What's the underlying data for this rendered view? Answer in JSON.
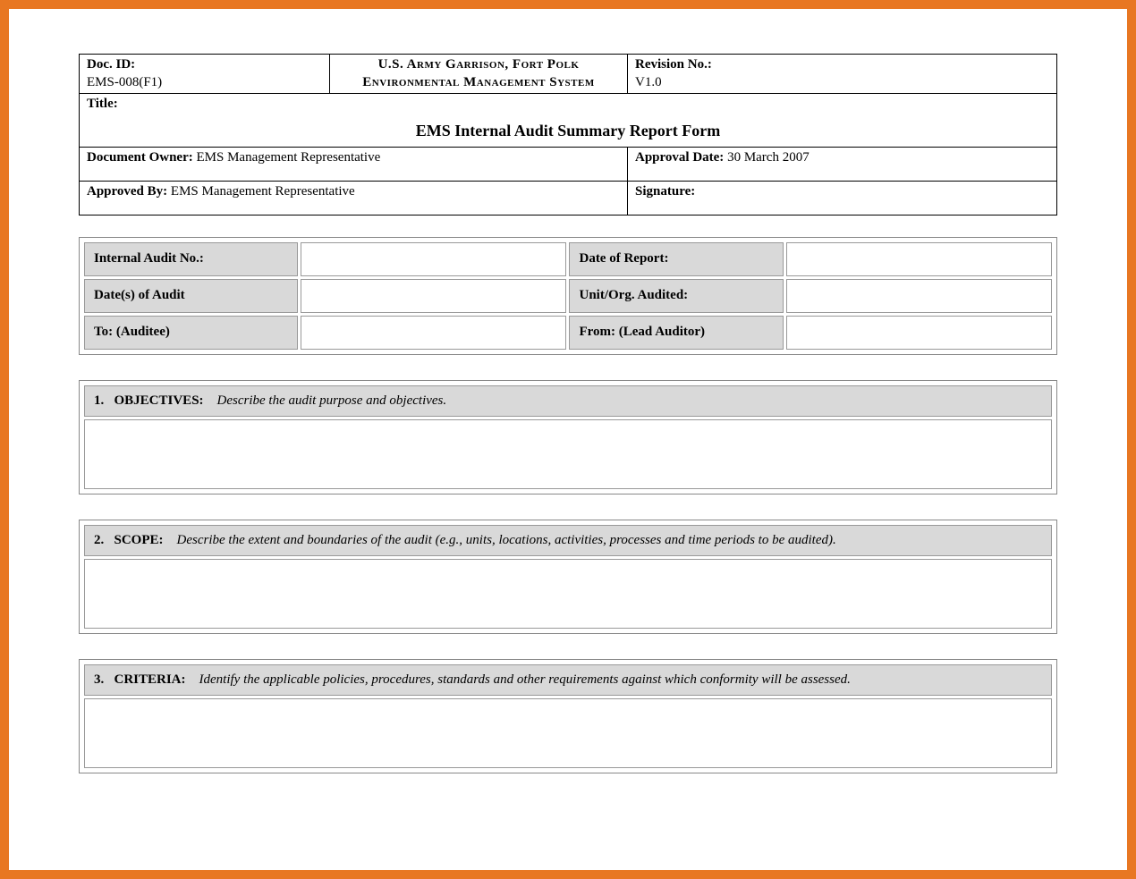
{
  "header": {
    "doc_id_label": "Doc. ID:",
    "doc_id_value": "EMS-008(F1)",
    "org_line1": "U.S. Army Garrison, Fort Polk",
    "org_line2": "Environmental Management System",
    "revision_label": "Revision No.:",
    "revision_value": "V1.0",
    "title_label": "Title:",
    "form_title": "EMS Internal Audit Summary Report Form",
    "doc_owner_label": "Document Owner:",
    "doc_owner_value": "EMS Management Representative",
    "approval_date_label": "Approval Date:",
    "approval_date_value": "30 March 2007",
    "approved_by_label": "Approved By:",
    "approved_by_value": "EMS Management Representative",
    "signature_label": "Signature:"
  },
  "info": {
    "audit_no_label": "Internal Audit No.:",
    "audit_no_value": "",
    "date_report_label": "Date of Report:",
    "date_report_value": "",
    "dates_audit_label": "Date(s) of Audit",
    "dates_audit_value": "",
    "unit_org_label": "Unit/Org. Audited:",
    "unit_org_value": "",
    "to_label": "To: (Auditee)",
    "to_value": "",
    "from_label": "From: (Lead Auditor)",
    "from_value": ""
  },
  "sections": {
    "s1_num": "1.",
    "s1_title": "OBJECTIVES:",
    "s1_desc": "Describe the audit purpose and objectives.",
    "s1_body": "",
    "s2_num": "2.",
    "s2_title": "SCOPE:",
    "s2_desc": "Describe the extent and boundaries of the audit (e.g., units, locations, activities, processes and time periods to be audited).",
    "s2_body": "",
    "s3_num": "3.",
    "s3_title": "CRITERIA:",
    "s3_desc": "Identify the applicable policies, procedures, standards and other requirements against which conformity will be assessed.",
    "s3_body": ""
  }
}
